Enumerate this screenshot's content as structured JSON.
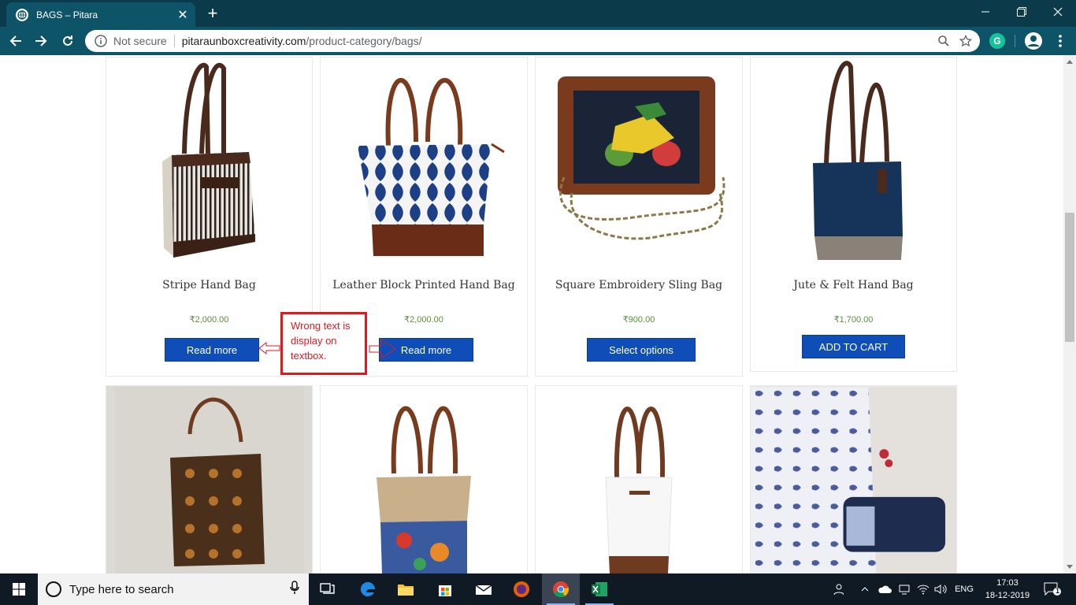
{
  "browser": {
    "tab_title": "BAGS – Pitara",
    "security_label": "Not secure",
    "url_host": "pitaraunboxcreativity.com",
    "url_path": "/product-category/bags/",
    "extension_letter": "G"
  },
  "products": [
    {
      "name": "Stripe Hand Bag",
      "price": "₹2,000.00",
      "button": "Read more"
    },
    {
      "name": "Leather Block Printed Hand Bag",
      "price": "₹2,000.00",
      "button": "Read more"
    },
    {
      "name": "Square Embroidery Sling Bag",
      "price": "₹900.00",
      "button": "Select options"
    },
    {
      "name": "Jute & Felt Hand Bag",
      "price": "₹1,700.00",
      "button": "ADD TO CART"
    }
  ],
  "annotation": {
    "line1": "Wrong text is",
    "line2": "display on",
    "line3": "textbox.",
    "color": "#e0191f"
  },
  "taskbar": {
    "search_placeholder": "Type here to search",
    "language": "ENG",
    "time": "17:03",
    "date": "18-12-2019",
    "notification_count": "1"
  },
  "colors": {
    "chrome_dark": "#0b3a4a",
    "chrome_toolbar": "#0e5468",
    "button_blue": "#0f4eb8",
    "price_green": "#5a8d3a"
  }
}
